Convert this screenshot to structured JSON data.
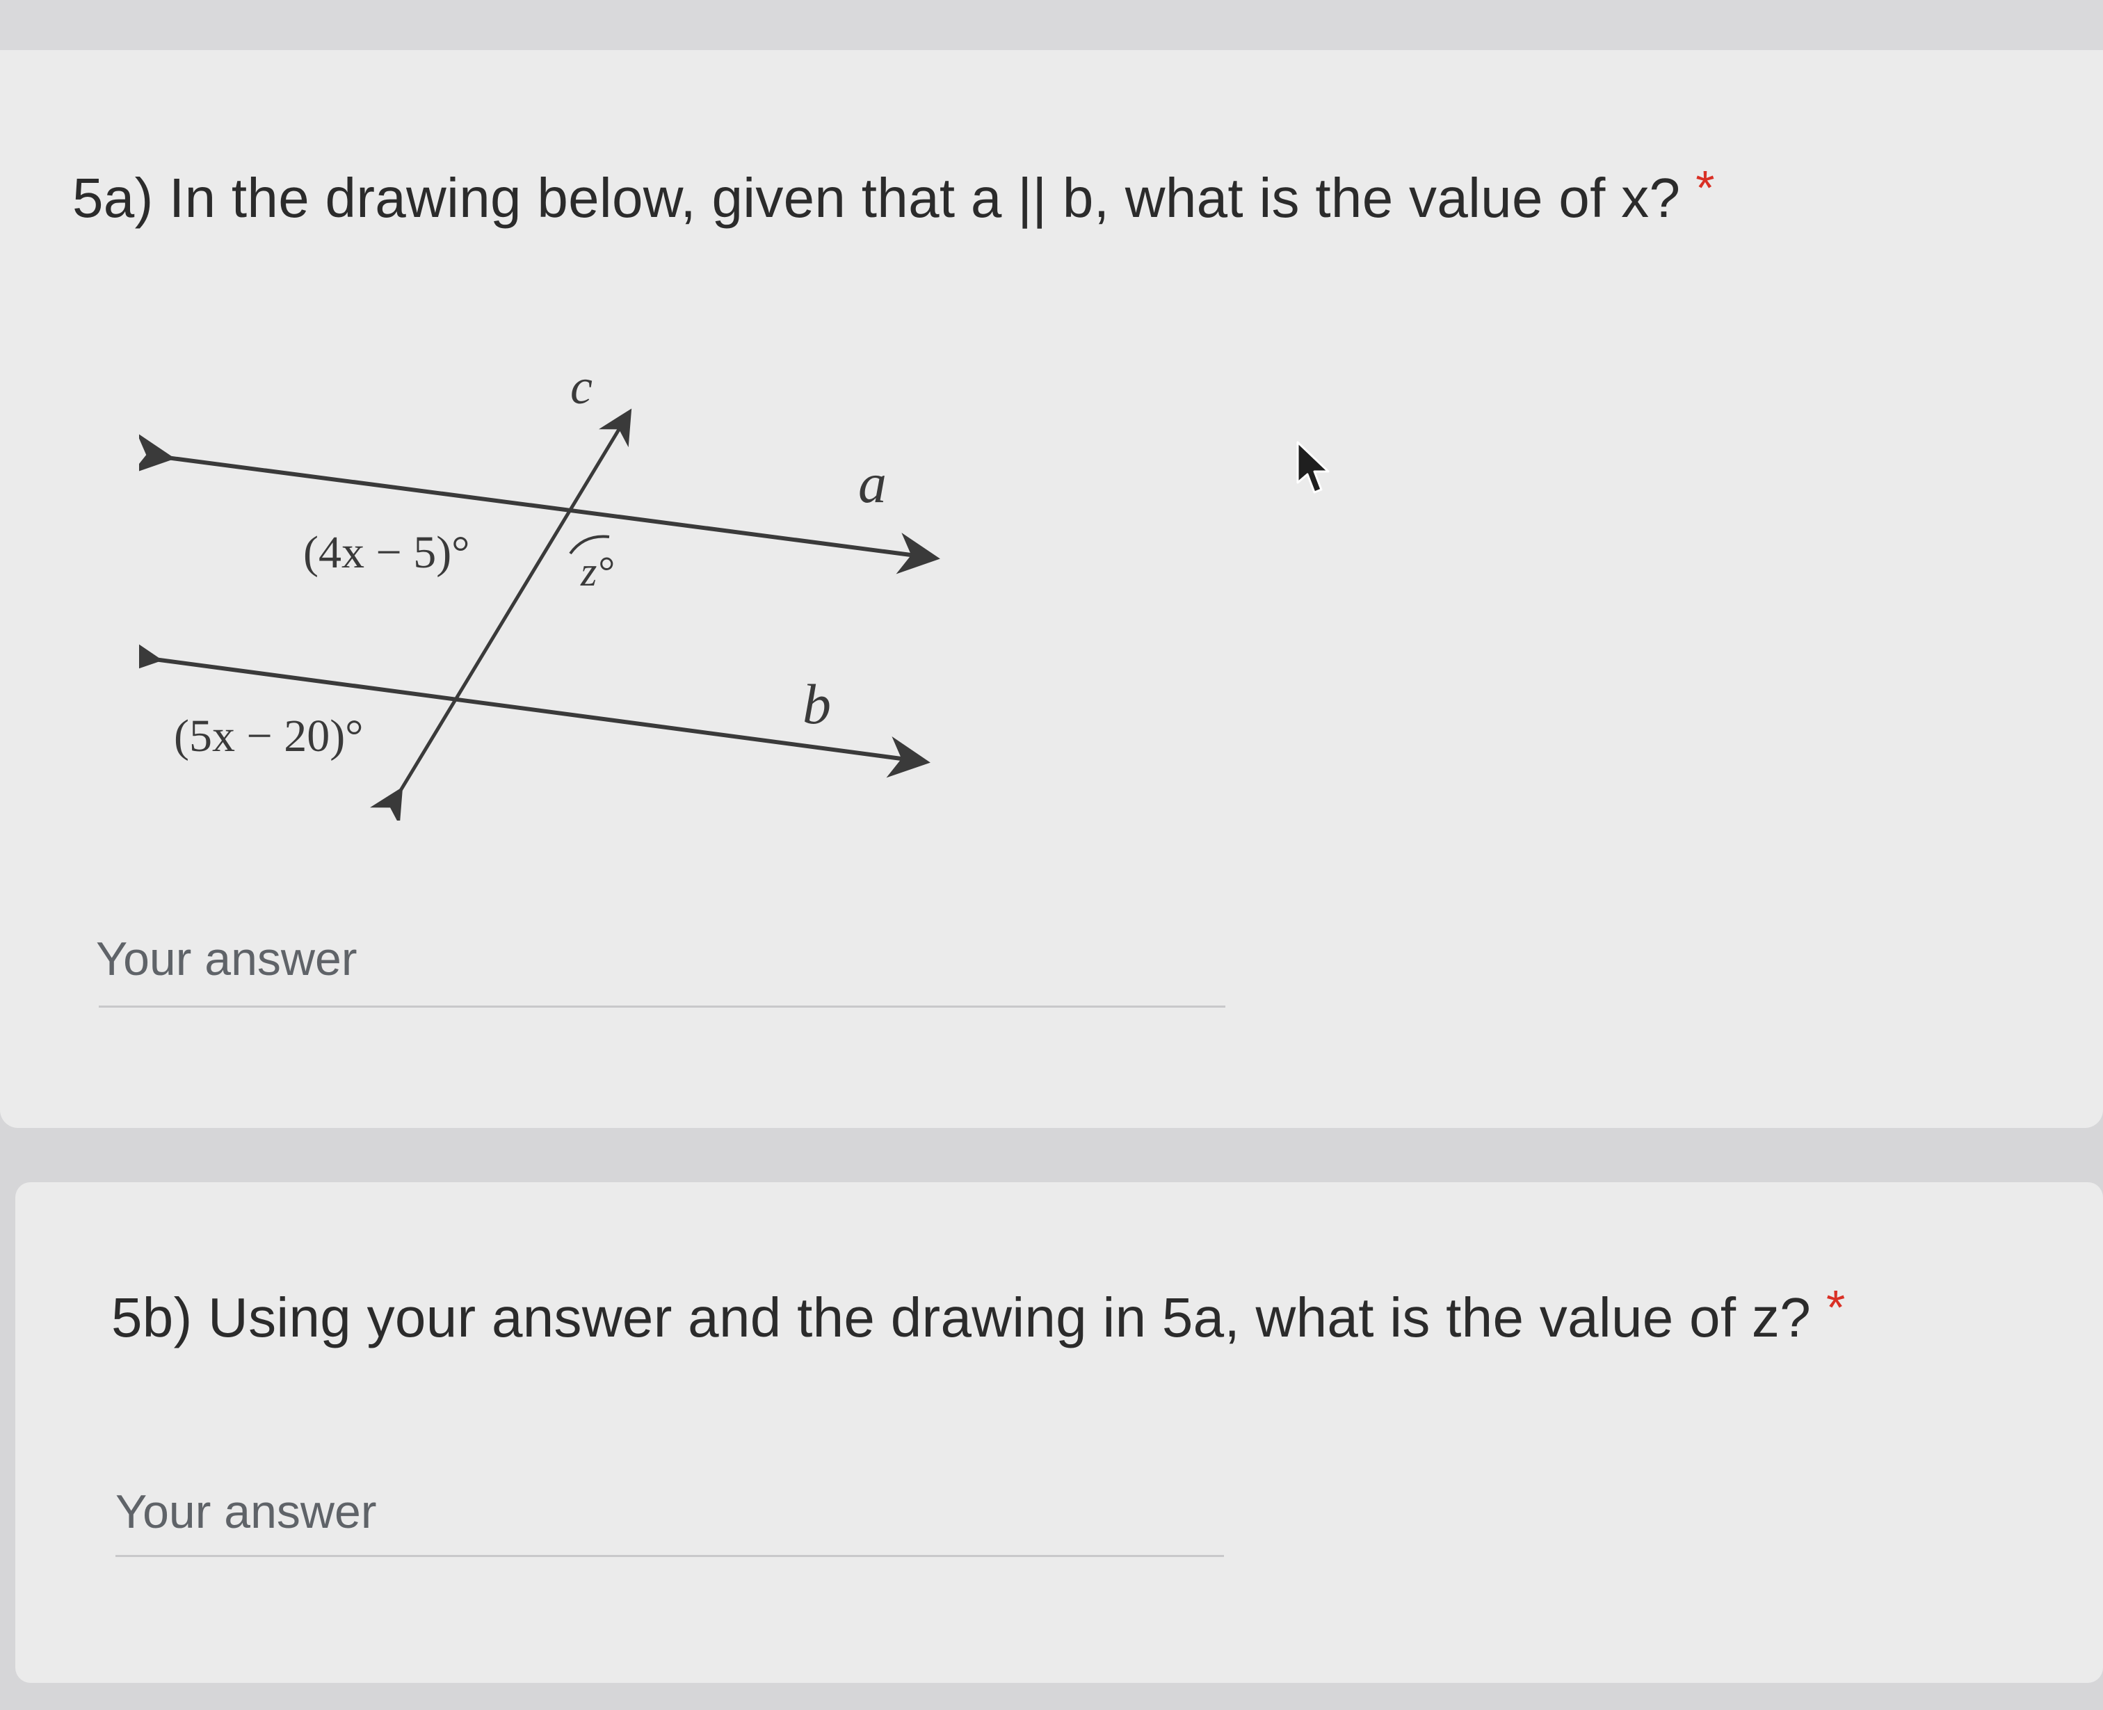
{
  "questions": [
    {
      "text": "5a) In the drawing below, given that a || b, what is the value of x?",
      "required_mark": "*",
      "answer_placeholder": "Your answer",
      "diagram": {
        "line_a": "a",
        "line_b": "b",
        "transversal": "c",
        "angle_top": "(4x − 5)°",
        "angle_z": "z°",
        "angle_bottom": "(5x − 20)°"
      }
    },
    {
      "text": "5b) Using your answer and the drawing in 5a, what is the value of z?",
      "required_mark": "*",
      "answer_placeholder": "Your answer"
    }
  ],
  "colors": {
    "required": "#d93025",
    "question_text": "#2b2b2b",
    "placeholder": "#5f6368"
  },
  "icons": [
    "mouse-pointer-icon"
  ]
}
